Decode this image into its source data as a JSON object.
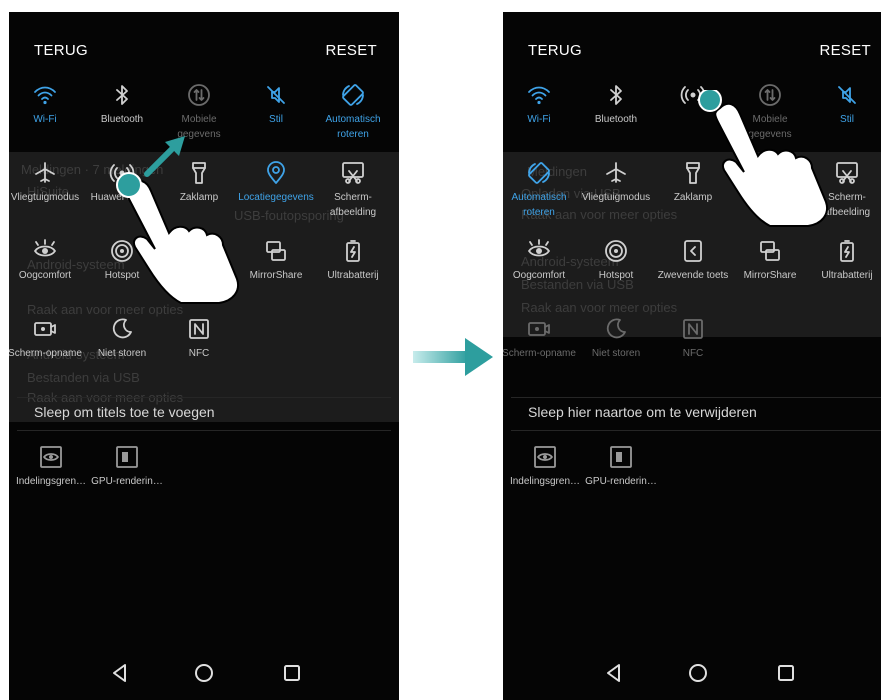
{
  "colors": {
    "accent": "#3fa3e8",
    "teal_pointer": "#2d9e9e",
    "panel": "#050505"
  },
  "left_screen": {
    "header": {
      "back": "TERUG",
      "reset": "RESET"
    },
    "background_ghost_text": [
      "Meldingen · 7 meldingen",
      "HiSuite",
      "USB-foutopsporing",
      "Android-systeem",
      "Raak aan voor meer opties",
      "Android-systeem",
      "Bestanden via USB",
      "Raak aan voor meer opties"
    ],
    "tiles": [
      {
        "label": "Wi-Fi",
        "icon": "wifi-icon",
        "state": "active"
      },
      {
        "label": "Bluetooth",
        "icon": "bluetooth-icon",
        "state": "normal"
      },
      {
        "label": "Mobiele gegevens",
        "icon": "mobile-data-icon",
        "state": "dim"
      },
      {
        "label": "Stil",
        "icon": "silent-icon",
        "state": "active"
      },
      {
        "label": "Automatisch roteren",
        "icon": "auto-rotate-icon",
        "state": "active"
      },
      {
        "label": "Vliegtuigmodus",
        "icon": "airplane-icon",
        "state": "normal"
      },
      {
        "label": "Huawei Share",
        "icon": "huawei-share-icon",
        "state": "normal"
      },
      {
        "label": "Zaklamp",
        "icon": "flashlight-icon",
        "state": "normal"
      },
      {
        "label": "Locatiegegevens",
        "icon": "location-icon",
        "state": "active"
      },
      {
        "label": "Scherm-afbeelding",
        "icon": "screenshot-icon",
        "state": "normal"
      },
      {
        "label": "Oogcomfort",
        "icon": "eye-comfort-icon",
        "state": "normal"
      },
      {
        "label": "Hotspot",
        "icon": "hotspot-icon",
        "state": "normal"
      },
      {
        "label": "",
        "icon": "",
        "state": "empty"
      },
      {
        "label": "MirrorShare",
        "icon": "mirrorshare-icon",
        "state": "normal"
      },
      {
        "label": "Ultrabatterij",
        "icon": "ultra-battery-icon",
        "state": "normal"
      },
      {
        "label": "Scherm-opname",
        "icon": "screen-record-icon",
        "state": "normal"
      },
      {
        "label": "Niet storen",
        "icon": "do-not-disturb-icon",
        "state": "normal"
      },
      {
        "label": "NFC",
        "icon": "nfc-icon",
        "state": "normal"
      }
    ],
    "hint": "Sleep om titels toe te voegen",
    "drag_tiles": [
      {
        "label": "Indelingsgren…",
        "icon": "layout-bounds-icon"
      },
      {
        "label": "GPU-renderin…",
        "icon": "gpu-rendering-icon"
      }
    ]
  },
  "right_screen": {
    "header": {
      "back": "TERUG",
      "reset": "RESET"
    },
    "background_ghost_text": [
      "Meldingen",
      "Opladen via USB",
      "Raak aan voor meer opties",
      "Android-systeem",
      "Bestanden via USB",
      "Raak aan voor meer opties"
    ],
    "tiles": [
      {
        "label": "Wi-Fi",
        "icon": "wifi-icon",
        "state": "active"
      },
      {
        "label": "Bluetooth",
        "icon": "bluetooth-icon",
        "state": "normal"
      },
      {
        "label": "",
        "icon": "huawei-share-icon",
        "state": "dragging"
      },
      {
        "label": "Mobiele gegevens",
        "icon": "mobile-data-icon",
        "state": "dim"
      },
      {
        "label": "Stil",
        "icon": "silent-icon",
        "state": "active"
      },
      {
        "label": "Automatisch roteren",
        "icon": "auto-rotate-icon",
        "state": "active"
      },
      {
        "label": "Vliegtuigmodus",
        "icon": "airplane-icon",
        "state": "normal"
      },
      {
        "label": "Zaklamp",
        "icon": "flashlight-icon",
        "state": "normal"
      },
      {
        "label": "",
        "icon": "",
        "state": "empty"
      },
      {
        "label": "Scherm-afbeelding",
        "icon": "screenshot-icon",
        "state": "normal"
      },
      {
        "label": "Oogcomfort",
        "icon": "eye-comfort-icon",
        "state": "normal"
      },
      {
        "label": "Hotspot",
        "icon": "hotspot-icon",
        "state": "normal"
      },
      {
        "label": "Zwevende toets",
        "icon": "floating-dock-icon",
        "state": "normal"
      },
      {
        "label": "MirrorShare",
        "icon": "mirrorshare-icon",
        "state": "normal"
      },
      {
        "label": "Ultrabatterij",
        "icon": "ultra-battery-icon",
        "state": "normal"
      },
      {
        "label": "Scherm-opname",
        "icon": "screen-record-icon",
        "state": "dim"
      },
      {
        "label": "Niet storen",
        "icon": "do-not-disturb-icon",
        "state": "dim"
      },
      {
        "label": "NFC",
        "icon": "nfc-icon",
        "state": "dim"
      }
    ],
    "hint": "Sleep hier naartoe om te verwijderen",
    "drag_tiles": [
      {
        "label": "Indelingsgren…",
        "icon": "layout-bounds-icon"
      },
      {
        "label": "GPU-renderin…",
        "icon": "gpu-rendering-icon"
      }
    ]
  },
  "navbar": {
    "back_icon": "back-triangle-icon",
    "home_icon": "home-circle-icon",
    "recents_icon": "recents-square-icon"
  },
  "transition_arrow_icon": "right-arrow-icon"
}
